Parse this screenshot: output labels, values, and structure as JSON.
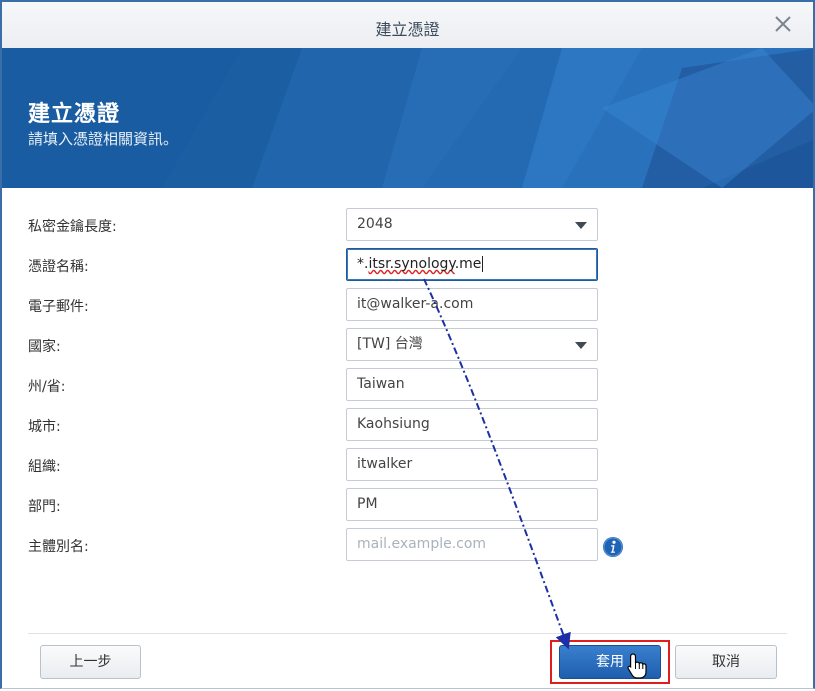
{
  "window": {
    "title": "建立憑證"
  },
  "banner": {
    "heading": "建立憑證",
    "subtitle": "請填入憑證相關資訊。"
  },
  "form": {
    "key_length": {
      "label": "私密金鑰長度:",
      "value": "2048"
    },
    "cert_name": {
      "label": "憑證名稱:",
      "value_prefix": "*.",
      "value_underlined": "itsr.synology",
      "value_suffix": ".me"
    },
    "email": {
      "label": "電子郵件:",
      "value": "it@walker-a.com"
    },
    "country": {
      "label": "國家:",
      "value": "[TW] 台灣"
    },
    "state": {
      "label": "州/省:",
      "value": "Taiwan"
    },
    "city": {
      "label": "城市:",
      "value": "Kaohsiung"
    },
    "organization": {
      "label": "組織:",
      "value": "itwalker"
    },
    "department": {
      "label": "部門:",
      "value": "PM"
    },
    "subject_alt_name": {
      "label": "主體別名:",
      "value": "",
      "placeholder": "mail.example.com"
    }
  },
  "buttons": {
    "back": "上一步",
    "apply": "套用",
    "cancel": "取消"
  },
  "icons": {
    "close": "close-icon",
    "dropdown": "chevron-down-icon",
    "info": "info-icon",
    "cursor": "hand-pointer-icon"
  },
  "colors": {
    "banner": "#1a5fa4",
    "primary_button": "#2a6cbd",
    "highlight": "#e01e1e",
    "arrow": "#1c2fa8"
  }
}
